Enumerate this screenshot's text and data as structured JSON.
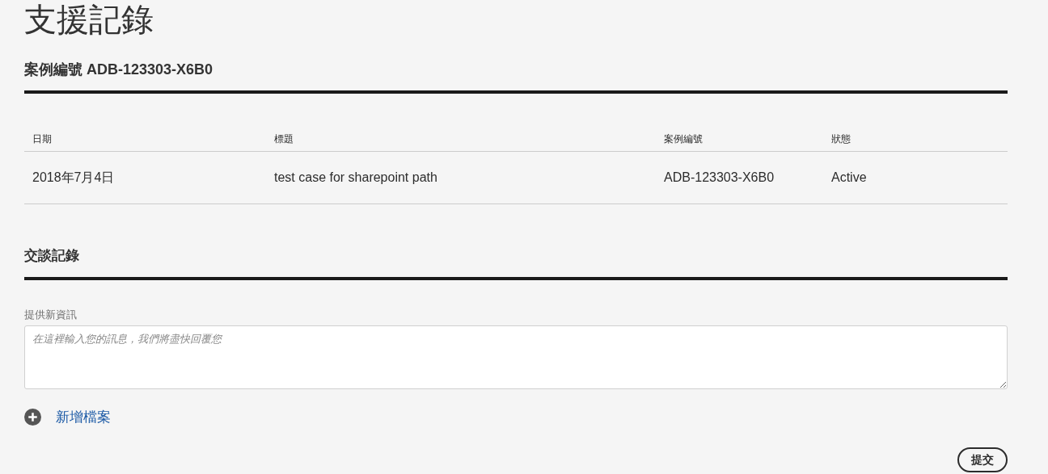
{
  "page_title": "支援記錄",
  "case_heading": "案例編號 ADB-123303-X6B0",
  "table": {
    "columns": [
      "日期",
      "標題",
      "案例編號",
      "狀態"
    ],
    "rows": [
      [
        "2018年7月4日",
        "test case for sharepoint path",
        "ADB-123303-X6B0",
        "Active"
      ]
    ]
  },
  "conversation": {
    "heading": "交談記錄",
    "field_label": "提供新資訊",
    "placeholder": "在這裡輸入您的訊息，我們將盡快回覆您",
    "add_file": "新增檔案",
    "submit": "提交"
  }
}
